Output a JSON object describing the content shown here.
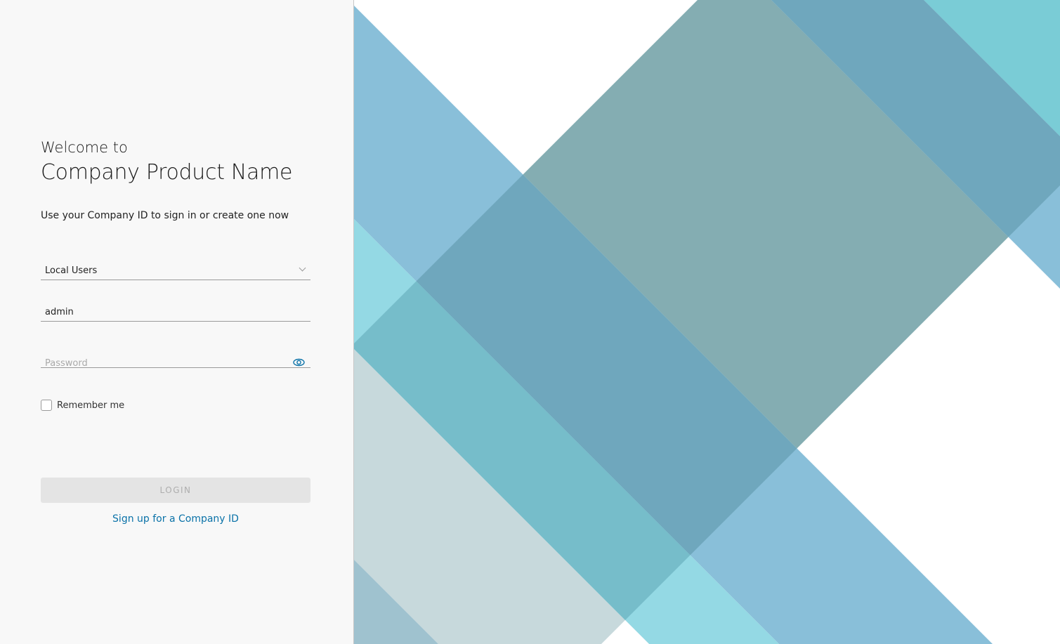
{
  "login_panel": {
    "welcome": "Welcome to",
    "product_name": "Company Product Name",
    "subtitle": "Use your Company ID to sign in or create one now",
    "domain_select": {
      "value": "Local Users"
    },
    "username": {
      "value": "admin"
    },
    "password": {
      "placeholder": "Password",
      "toggle_icon": "eye-icon"
    },
    "remember_me": {
      "label": "Remember me",
      "checked": false
    },
    "login_button": "LOGIN",
    "signup_link": "Sign up for a Company ID"
  },
  "colors": {
    "link": "#0a72a8",
    "light_blue": "#89bfd9",
    "dark_blue": "#6fa7bd",
    "gray_teal": "#84adb2",
    "teal": "#76bdca",
    "light_cyan": "#94d9e4",
    "cyan": "#7accd6",
    "pale_gray": "#c7d9dc"
  }
}
